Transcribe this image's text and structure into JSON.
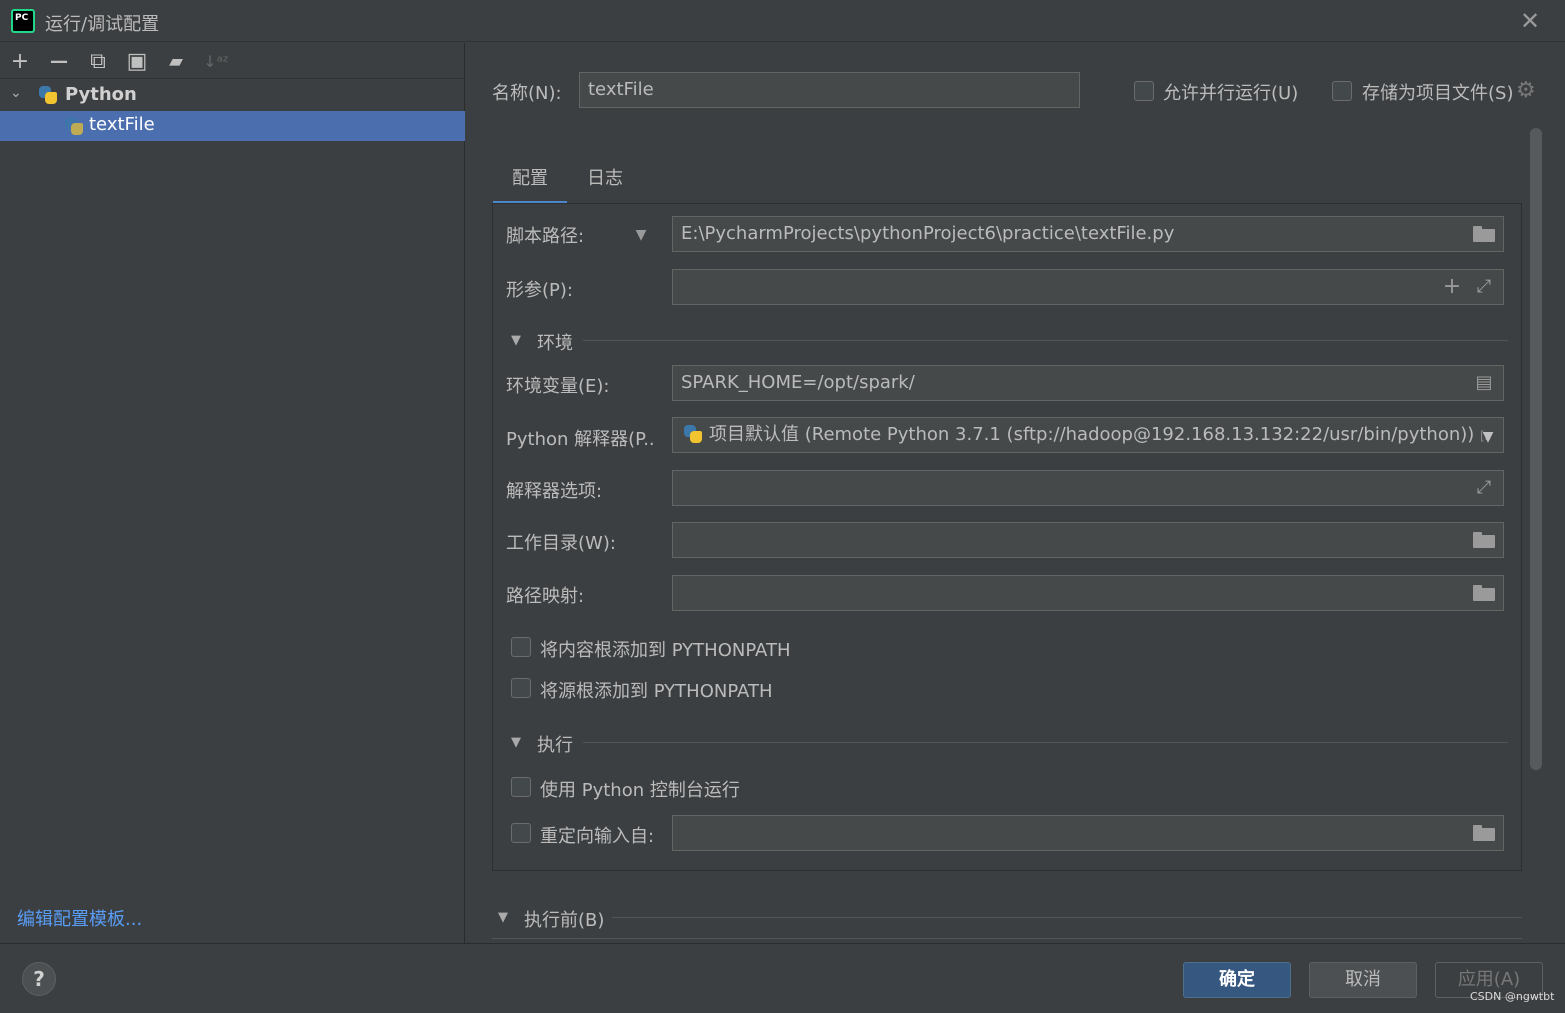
{
  "window": {
    "title": "运行/调试配置",
    "close_symbol": "✕",
    "logo_text": "PC"
  },
  "toolbar": {
    "items": [
      {
        "name": "add-icon",
        "glyph": "+"
      },
      {
        "name": "remove-icon",
        "glyph": "—"
      },
      {
        "name": "copy-icon",
        "glyph": "⧉"
      },
      {
        "name": "save-icon",
        "glyph": "▣"
      },
      {
        "name": "new-folder-icon",
        "glyph": "▰"
      },
      {
        "name": "sort-icon",
        "glyph": "↓ᵃᶻ"
      }
    ]
  },
  "tree": {
    "group_label": "Python",
    "selected_item": "textFile"
  },
  "edit_templates_link": "编辑配置模板...",
  "form": {
    "name_label": "名称(N):",
    "name_value": "textFile",
    "allow_parallel_label": "允许并行运行(U)",
    "store_as_project_label": "存储为项目文件(S)",
    "tabs": [
      "配置",
      "日志"
    ],
    "script_path_label": "脚本路径:",
    "script_path_value": "E:\\PycharmProjects\\pythonProject6\\practice\\textFile.py",
    "params_label": "形参(P):",
    "params_value": "",
    "env_section_label": "环境",
    "env_vars_label": "环境变量(E):",
    "env_vars_value": "SPARK_HOME=/opt/spark/",
    "interpreter_label": "Python 解释器(P..",
    "interpreter_value": "项目默认值 (Remote Python 3.7.1 (sftp://hadoop@192.168.13.132:22/usr/bin/python))",
    "interpreter_suffix": "[s",
    "interpreter_options_label": "解释器选项:",
    "interpreter_options_value": "",
    "working_dir_label": "工作目录(W):",
    "working_dir_value": "",
    "path_mappings_label": "路径映射:",
    "path_mappings_value": "",
    "add_content_roots_label": "将内容根添加到 PYTHONPATH",
    "add_source_roots_label": "将源根添加到 PYTHONPATH",
    "exec_section_label": "执行",
    "use_console_label": "使用 Python 控制台运行",
    "redirect_input_label": "重定向输入自:",
    "redirect_input_value": "",
    "before_launch_label": "执行前(B)"
  },
  "buttons": {
    "help": "?",
    "ok": "确定",
    "cancel": "取消",
    "apply": "应用(A)"
  },
  "watermark": "CSDN @ngwtbt",
  "colors": {
    "background": "#3c3f41",
    "selection": "#4b6eaf",
    "link": "#589df6",
    "primary_button": "#365880",
    "tab_underline": "#4a88c7"
  }
}
